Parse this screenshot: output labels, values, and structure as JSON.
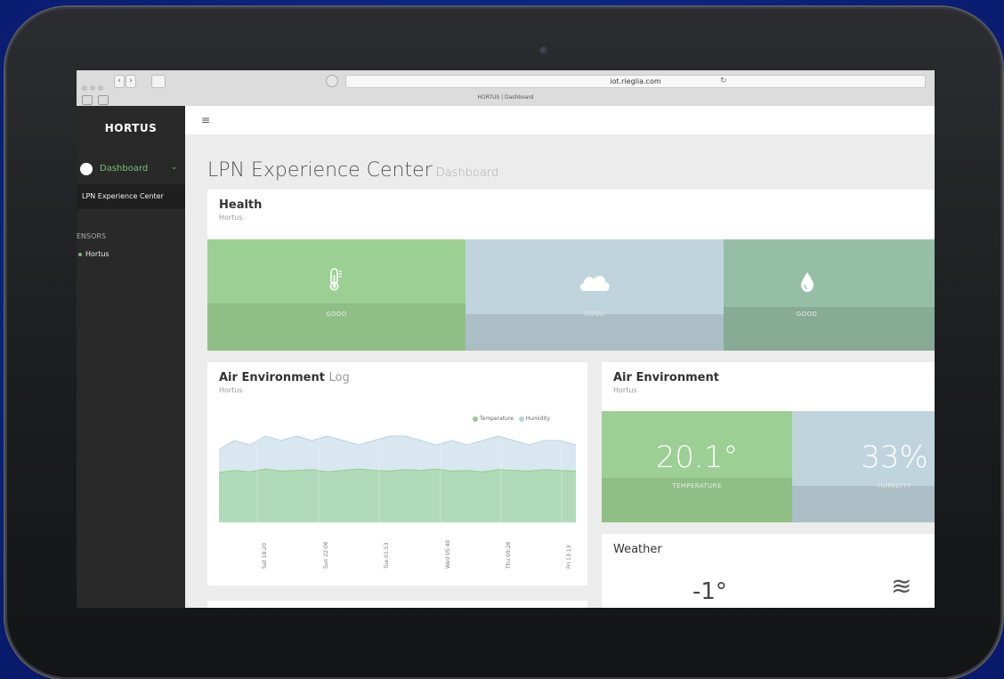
{
  "browser": {
    "url": "iot.rieglia.com",
    "tab_title": "HORTUS | Dashboard",
    "back_label": "‹",
    "forward_label": "›",
    "reload_glyph": "↻"
  },
  "sidebar": {
    "brand": "HORTUS",
    "nav_dashboard": "Dashboard",
    "nav_chevron": "⌄",
    "nav_sub": "LPN Experience Center",
    "sensors_heading": "ENSORS",
    "sensor_item": "Hortus"
  },
  "topbar": {
    "menu_glyph": "≡"
  },
  "page": {
    "title": "LPN Experience Center",
    "subtitle": "Dashboard"
  },
  "health": {
    "title": "Health",
    "subtitle": "Hortus",
    "tiles": [
      {
        "icon": "thermometer-icon",
        "label": "GOOD",
        "color": "#9ccf93",
        "bottom_color": "#8fbe86"
      },
      {
        "icon": "cloud-icon",
        "label": "GOOD",
        "color": "#bfd4dd",
        "bottom_color": "#abbec6"
      },
      {
        "icon": "water-drop-icon",
        "label": "GOOD",
        "color": "#96bea6",
        "bottom_color": "#87ab95"
      }
    ]
  },
  "air_log": {
    "title": "Air Environment",
    "title_suffix": "Log",
    "subtitle": "Hortus"
  },
  "chart_data": {
    "type": "area",
    "legend_placement": "top-right",
    "x": [
      "Sat 18:20",
      "Sun 22:06",
      "Tue 01:53",
      "Wed 05:40",
      "Thu 09:26",
      "Fri 13:13"
    ],
    "series": [
      {
        "name": "Temperature",
        "color": "#8fcf8c",
        "values": [
          20.3,
          20.6,
          20.4,
          20.8,
          20.5,
          20.6,
          20.7,
          20.4,
          20.6,
          20.8,
          20.6,
          20.5,
          20.7,
          20.6,
          20.8,
          20.5,
          20.6,
          20.4,
          20.7,
          20.6,
          20.5,
          20.7,
          20.6,
          20.5
        ]
      },
      {
        "name": "Humidity",
        "color": "#b9d3e4",
        "values": [
          34,
          36,
          35,
          37,
          36,
          37,
          36,
          37,
          36,
          35,
          36,
          37,
          37,
          36,
          35,
          36,
          35,
          36,
          37,
          36,
          35,
          36,
          36,
          35
        ]
      }
    ]
  },
  "air_env": {
    "title": "Air Environment",
    "subtitle": "Hortus",
    "temperature_value": "20.1°",
    "temperature_label": "TEMPERATURE",
    "humidity_value": "33%",
    "humidity_label": "HUMIDITY",
    "temperature_color": "#9ccf93",
    "humidity_color": "#bfd4dd"
  },
  "weather": {
    "title": "Weather",
    "temperature": "-1°",
    "icon": "wind-icon",
    "icon_glyph": "≋"
  }
}
